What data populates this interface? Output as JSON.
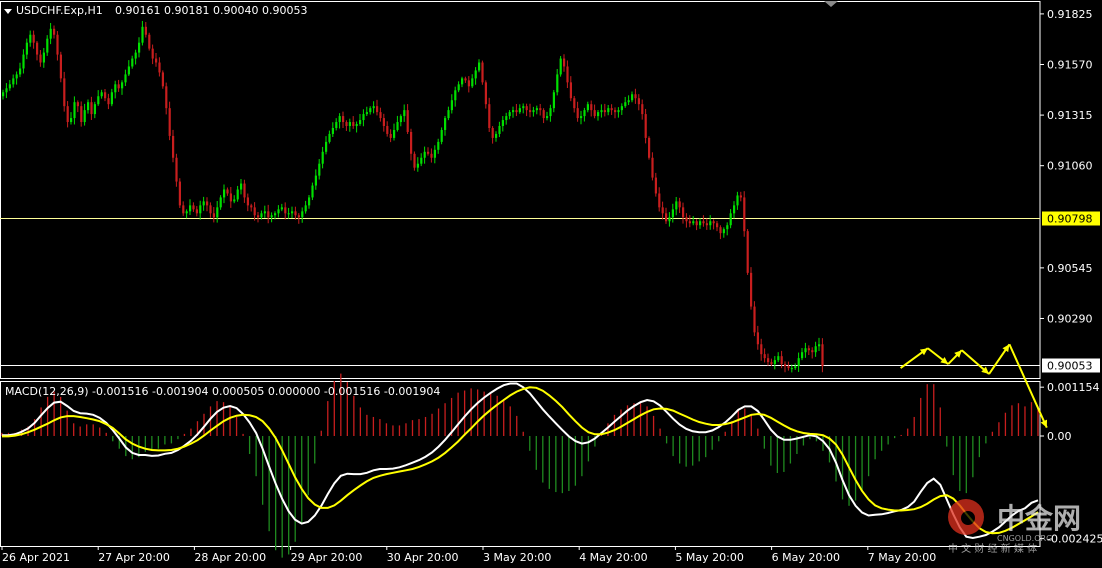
{
  "header": {
    "symbol_label": "USDCHF.Exp,H1",
    "ohlc_label": "0.90161 0.90181 0.90040 0.90053"
  },
  "macd": {
    "label": "MACD(12,26,9) -0.001516 -0.001904 0.000505 0.000000 -0.001516 -0.001904"
  },
  "watermark": {
    "brand": "中金网",
    "domain": "CNGOLD.ORG",
    "tagline": "中 文 财 经 新 媒 体"
  },
  "colors": {
    "background": "#000000",
    "bull": "#00e000",
    "bear": "#c81e1e",
    "level_line_yellow": "#ffff99",
    "level_line_white": "#ffffff",
    "tag_yellow": "#ffff00",
    "macd_main": "#ffffff",
    "macd_signal": "#ffff00",
    "macd_hist_pos": "#c81e1e",
    "macd_hist_neg": "#1f8a1f",
    "arrows": "#ffff00",
    "watermark_red": "#e0301e"
  },
  "chart_data": [
    {
      "type": "candlestick",
      "pane": "price",
      "title": "USDCHF.Exp,H1",
      "ohlc_last": {
        "open": 0.90161,
        "high": 0.90181,
        "low": 0.9004,
        "close": 0.90053
      },
      "ylim": [
        0.8999,
        0.9189
      ],
      "y_ticks": [
        {
          "value": 0.91825,
          "label": "0.91825"
        },
        {
          "value": 0.9157,
          "label": "0.91570"
        },
        {
          "value": 0.91315,
          "label": "0.91315"
        },
        {
          "value": 0.9106,
          "label": "0.91060"
        },
        {
          "value": 0.90545,
          "label": "0.90545"
        },
        {
          "value": 0.9029,
          "label": "0.90290"
        }
      ],
      "levels": [
        {
          "value": 0.90798,
          "label": "0.90798",
          "color": "#ffff99",
          "tag": "yellow"
        },
        {
          "value": 0.90053,
          "label": "0.90053",
          "color": "#ffffff",
          "tag": "white"
        }
      ],
      "x_ticks": [
        "26 Apr 2021",
        "27 Apr 20:00",
        "28 Apr 20:00",
        "29 Apr 20:00",
        "30 Apr 20:00",
        "3 May 20:00",
        "4 May 20:00",
        "5 May 20:00",
        "6 May 20:00",
        "7 May 20:00"
      ],
      "closes": [
        0.9143,
        0.9145,
        0.9147,
        0.915,
        0.9152,
        0.9155,
        0.9162,
        0.9168,
        0.9172,
        0.9168,
        0.9162,
        0.9158,
        0.9163,
        0.917,
        0.9175,
        0.9172,
        0.9162,
        0.915,
        0.9136,
        0.9128,
        0.913,
        0.9138,
        0.9136,
        0.9128,
        0.9134,
        0.9138,
        0.9132,
        0.9137,
        0.9141,
        0.9143,
        0.914,
        0.9137,
        0.9143,
        0.9147,
        0.9145,
        0.9148,
        0.9152,
        0.9156,
        0.916,
        0.9163,
        0.9168,
        0.9176,
        0.9172,
        0.9165,
        0.916,
        0.9158,
        0.9153,
        0.9146,
        0.9135,
        0.9121,
        0.911,
        0.9098,
        0.9086,
        0.9082,
        0.9083,
        0.9086,
        0.9084,
        0.9082,
        0.9086,
        0.9088,
        0.9086,
        0.9082,
        0.908,
        0.9085,
        0.909,
        0.9094,
        0.9092,
        0.9088,
        0.9089,
        0.9094,
        0.9097,
        0.909,
        0.9086,
        0.9085,
        0.9081,
        0.908,
        0.9082,
        0.9083,
        0.908,
        0.9081,
        0.9082,
        0.9084,
        0.9085,
        0.9082,
        0.9082,
        0.9083,
        0.9081,
        0.908,
        0.9083,
        0.9086,
        0.909,
        0.9096,
        0.9101,
        0.9107,
        0.9113,
        0.9118,
        0.9122,
        0.9125,
        0.9128,
        0.9131,
        0.9128,
        0.9126,
        0.9128,
        0.9126,
        0.9127,
        0.9129,
        0.9132,
        0.9133,
        0.9135,
        0.9136,
        0.9133,
        0.913,
        0.9126,
        0.9122,
        0.912,
        0.9124,
        0.9128,
        0.9131,
        0.9134,
        0.9123,
        0.9112,
        0.9105,
        0.9107,
        0.911,
        0.9113,
        0.9112,
        0.911,
        0.9114,
        0.9118,
        0.9124,
        0.913,
        0.9134,
        0.9139,
        0.9144,
        0.9147,
        0.915,
        0.9149,
        0.9146,
        0.915,
        0.9154,
        0.9158,
        0.9148,
        0.9137,
        0.9125,
        0.912,
        0.9122,
        0.9126,
        0.9129,
        0.9131,
        0.9133,
        0.9134,
        0.9133,
        0.9135,
        0.9136,
        0.9134,
        0.9133,
        0.9134,
        0.9135,
        0.9134,
        0.913,
        0.9131,
        0.9135,
        0.9143,
        0.9152,
        0.916,
        0.9156,
        0.9148,
        0.914,
        0.9135,
        0.913,
        0.9131,
        0.9134,
        0.9137,
        0.9134,
        0.9131,
        0.9133,
        0.9134,
        0.9133,
        0.9135,
        0.9134,
        0.9133,
        0.9134,
        0.9136,
        0.9138,
        0.9139,
        0.9142,
        0.914,
        0.9137,
        0.9132,
        0.912,
        0.911,
        0.91,
        0.9092,
        0.9085,
        0.9082,
        0.9078,
        0.908,
        0.9084,
        0.9088,
        0.9085,
        0.908,
        0.9078,
        0.9077,
        0.9078,
        0.9076,
        0.9078,
        0.9077,
        0.9076,
        0.9078,
        0.9077,
        0.9075,
        0.9072,
        0.9074,
        0.9076,
        0.9082,
        0.9086,
        0.9091,
        0.909,
        0.9073,
        0.9052,
        0.9035,
        0.9022,
        0.9016,
        0.9011,
        0.9009,
        0.9007,
        0.9006,
        0.9008,
        0.901,
        0.9006,
        0.9005,
        0.9004,
        0.9004,
        0.9005,
        0.9009,
        0.9012,
        0.9014,
        0.9013,
        0.9012,
        0.9015,
        0.9016,
        0.9005
      ],
      "forecast_path": [
        {
          "bar": 264,
          "price": 0.9004
        },
        {
          "bar": 272,
          "price": 0.9014
        },
        {
          "bar": 278,
          "price": 0.9006
        },
        {
          "bar": 282,
          "price": 0.9013
        },
        {
          "bar": 290,
          "price": 0.9001
        },
        {
          "bar": 296,
          "price": 0.9016
        },
        {
          "bar": 307,
          "price": 0.8974
        }
      ]
    },
    {
      "type": "line",
      "pane": "macd",
      "title": "MACD(12,26,9)",
      "ylim": [
        -0.0026,
        0.0013
      ],
      "y_ticks": [
        {
          "value": 0.001154,
          "label": "0.001154"
        },
        {
          "value": 0.0,
          "label": "0.00"
        },
        {
          "value": -0.002425,
          "label": "-0.002425"
        }
      ],
      "series": [
        {
          "key": "main",
          "color": "#ffffff",
          "values": [
            2e-05,
            2e-05,
            4e-05,
            0.0001,
            0.00018,
            0.00031,
            0.00049,
            0.00066,
            0.00079,
            0.00081,
            0.00071,
            0.00059,
            0.00054,
            0.00053,
            0.0005,
            0.00043,
            0.00031,
            0.00014,
            -6e-05,
            -0.00027,
            -0.0004,
            -0.00045,
            -0.00045,
            -0.00047,
            -0.00046,
            -0.00042,
            -0.0004,
            -0.00033,
            -0.00023,
            -0.00011,
            4e-05,
            0.00022,
            0.00041,
            0.00057,
            0.00067,
            0.00071,
            0.00066,
            0.00052,
            0.00032,
            7e-05,
            -0.0003,
            -0.00072,
            -0.00113,
            -0.00149,
            -0.00178,
            -0.00198,
            -0.00207,
            -0.00203,
            -0.00188,
            -0.00165,
            -0.00137,
            -0.00112,
            -0.00094,
            -0.00089,
            -0.0009,
            -0.0009,
            -0.00087,
            -0.00081,
            -0.00078,
            -0.00078,
            -0.00077,
            -0.00074,
            -0.00069,
            -0.00063,
            -0.00057,
            -0.00049,
            -0.00039,
            -0.00025,
            -9e-05,
            9e-05,
            0.00028,
            0.00046,
            0.00063,
            0.00078,
            0.00091,
            0.00102,
            0.00112,
            0.0012,
            0.00124,
            0.00124,
            0.00115,
            0.00101,
            0.00082,
            0.00063,
            0.00046,
            0.0003,
            0.00014,
            -1e-05,
            -0.00012,
            -0.00018,
            -0.00015,
            -6e-05,
            7e-05,
            0.0002,
            0.00034,
            0.00047,
            0.0006,
            0.00071,
            0.0008,
            0.00085,
            0.00082,
            0.00072,
            0.00057,
            0.00041,
            0.00027,
            0.00017,
            0.00011,
            9e-05,
            9e-05,
            0.00013,
            0.00021,
            0.00032,
            0.00046,
            0.00062,
            0.0007,
            0.0007,
            0.00059,
            0.00038,
            0.00015,
            -1e-05,
            -9e-05,
            -9e-05,
            -6e-05,
            -2e-05,
            2e-05,
            -1e-05,
            -0.00012,
            -0.00031,
            -0.00063,
            -0.00104,
            -0.0014,
            -0.00165,
            -0.00181,
            -0.00188,
            -0.00186,
            -0.00185,
            -0.00182,
            -0.00178,
            -0.00175,
            -0.00168,
            -0.00155,
            -0.00132,
            -0.00111,
            -0.00101,
            -0.00115,
            -0.0015,
            -0.00185,
            -0.00216,
            -0.00238,
            -0.00241,
            -0.00238,
            -0.00234,
            -0.00226,
            -0.00216,
            -0.00202,
            -0.00188,
            -0.00177,
            -0.00171,
            -0.00158,
            -0.00152
          ]
        },
        {
          "key": "signal",
          "color": "#ffff00",
          "values": [
            -1e-05,
            -1e-05,
            1e-05,
            4e-05,
            9e-05,
            0.00015,
            0.00022,
            0.00029,
            0.00037,
            0.00044,
            0.00047,
            0.00047,
            0.00045,
            0.00042,
            0.00039,
            0.00035,
            0.00028,
            0.00019,
            6e-05,
            -8e-05,
            -0.00018,
            -0.00025,
            -0.0003,
            -0.00033,
            -0.00034,
            -0.00034,
            -0.00033,
            -0.0003,
            -0.00025,
            -0.00018,
            -0.0001,
            1e-05,
            0.00013,
            0.00024,
            0.00035,
            0.00043,
            0.00048,
            0.0005,
            0.00049,
            0.00045,
            0.00035,
            0.00018,
            -5e-05,
            -0.00034,
            -0.00066,
            -0.00098,
            -0.00125,
            -0.00147,
            -0.00162,
            -0.0017,
            -0.0017,
            -0.00164,
            -0.00153,
            -0.0014,
            -0.00128,
            -0.00117,
            -0.00107,
            -0.00099,
            -0.00094,
            -0.0009,
            -0.00087,
            -0.00084,
            -0.00081,
            -0.00078,
            -0.00073,
            -0.00067,
            -0.0006,
            -0.00051,
            -0.0004,
            -0.00027,
            -0.00013,
            3e-05,
            0.00018,
            0.00034,
            0.00049,
            0.00062,
            0.00074,
            0.00085,
            0.00096,
            0.00105,
            0.00111,
            0.00115,
            0.00114,
            0.00107,
            0.00096,
            0.00083,
            0.00068,
            0.00051,
            0.00035,
            0.0002,
            9e-05,
            4e-05,
            4e-05,
            8e-05,
            0.00014,
            0.00022,
            0.00031,
            0.0004,
            0.00049,
            0.00057,
            0.00063,
            0.00065,
            0.00064,
            0.0006,
            0.00053,
            0.00046,
            0.00039,
            0.00033,
            0.00029,
            0.00026,
            0.00026,
            0.00028,
            0.00032,
            0.00038,
            0.00044,
            0.0005,
            0.00052,
            0.0005,
            0.00043,
            0.00034,
            0.00025,
            0.00017,
            0.00011,
            7e-05,
            5e-05,
            4e-05,
            2e-05,
            -6e-05,
            -0.0002,
            -0.00044,
            -0.00074,
            -0.00104,
            -0.0013,
            -0.0015,
            -0.00164,
            -0.00171,
            -0.00174,
            -0.00176,
            -0.00176,
            -0.00175,
            -0.00173,
            -0.00168,
            -0.0016,
            -0.0015,
            -0.00142,
            -0.0014,
            -0.00148,
            -0.00164,
            -0.00184,
            -0.00202,
            -0.00218,
            -0.00227,
            -0.0023,
            -0.00229,
            -0.00224,
            -0.00217,
            -0.00208,
            -0.00199,
            -0.0019,
            -0.0018
          ]
        }
      ],
      "histogram_note": "histogram derived as main minus signal"
    }
  ]
}
